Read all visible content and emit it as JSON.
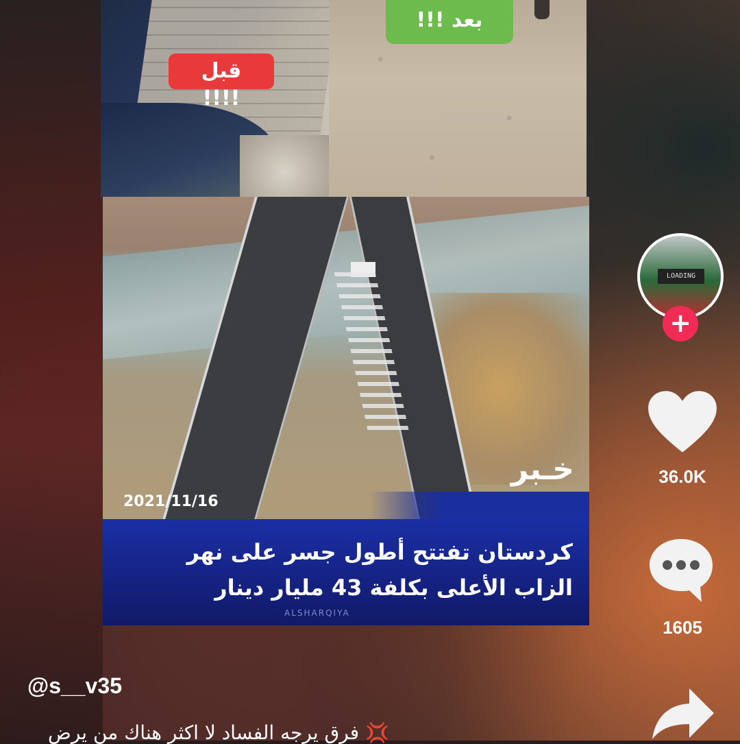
{
  "media": {
    "before_label": "قبل !!!!",
    "after_label": "بعد !!!",
    "news": {
      "title": "خـبر",
      "date": "2021/11/16",
      "headline_line1": "كردستان تفتتح  أطول جسر على نهر",
      "headline_line2": "الزاب الأعلى بكلفة 43 مليار دينار",
      "watermark": "ALSHARQIYA"
    }
  },
  "actions": {
    "avatar_text": "LOADING",
    "follow_symbol": "+",
    "like_count": "36.0K",
    "comment_count": "1605"
  },
  "author": {
    "username": "@s__v35"
  },
  "caption": "💢 فرق يرجه الفساد لا اكثر هناك من يرض",
  "colors": {
    "follow": "#f02b55",
    "before_tag": "#e83a3a",
    "after_tag": "#6dbb4c",
    "news_band": "#1b2fa6"
  }
}
